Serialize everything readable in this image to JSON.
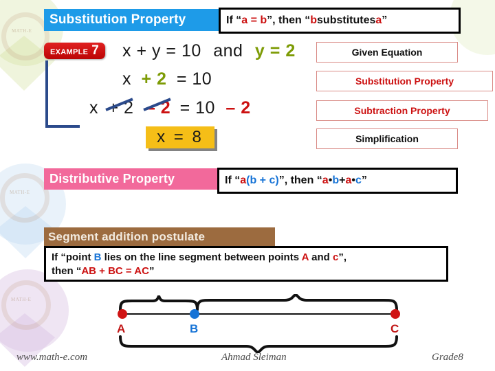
{
  "colors": {
    "substitution_banner": "#1E9BE8",
    "distributive_banner": "#F2699B",
    "segment_banner": "#9C6B3F",
    "example_badge": "#CC1111",
    "answer_highlight": "#F5BE17",
    "connector": "#2B4A8B",
    "accent_red": "#CC1111",
    "accent_blue": "#1673D6",
    "accent_green": "#7D9B05"
  },
  "substitution": {
    "banner_label": "Substitution Property",
    "rule": {
      "prefix": "If “",
      "a": "a = b",
      "middle": "”, then “",
      "b1": "b",
      "mid2": " substitutes ",
      "b2": "a",
      "suffix": "”"
    }
  },
  "example": {
    "label": "EXAMPLE",
    "number": "7",
    "lines": [
      {
        "black_1": "x + y = 10",
        "and": "and",
        "green": "y = 2",
        "reason": "Given Equation",
        "reason_color": "black"
      },
      {
        "black_1": "x",
        "green": "+ 2",
        "black_2": "= 10",
        "reason": "Substitution Property",
        "reason_color": "red"
      },
      {
        "black_1": "x",
        "struck_black": "+ 2",
        "struck_red": "– 2",
        "black_2": "= 10",
        "red": "– 2",
        "reason": "Subtraction Property",
        "reason_color": "red"
      },
      {
        "answer": "x  =  8",
        "reason": "Simplification",
        "reason_color": "black"
      }
    ]
  },
  "distributive": {
    "banner_label": "Distributive Property",
    "rule": {
      "prefix": "If “",
      "a1": "a",
      "bc": "(b + c)",
      "middle": "”, then “",
      "a2": "a",
      "dot1": "•",
      "b": "b",
      "plus": " + ",
      "a3": "a",
      "dot2": "•",
      "c": "c",
      "suffix": "”"
    }
  },
  "segment": {
    "banner_label": "Segment addition postulate",
    "body": {
      "l1_p1": "If “point ",
      "l1_B": "B",
      "l1_p2": " lies on the line segment between points ",
      "l1_A": "A",
      "l1_p3": " and ",
      "l1_c": "c",
      "l1_p4": "”,",
      "l2_p1": "then “",
      "l2_eq": "AB + BC = AC",
      "l2_p2": "”"
    },
    "points": {
      "a": "A",
      "b": "B",
      "c": "C"
    }
  },
  "footer": {
    "site": "www.math-e.com",
    "author": "Ahmad Sleiman",
    "grade": "Grade8"
  },
  "watermark": {
    "label": "MATH-E"
  }
}
